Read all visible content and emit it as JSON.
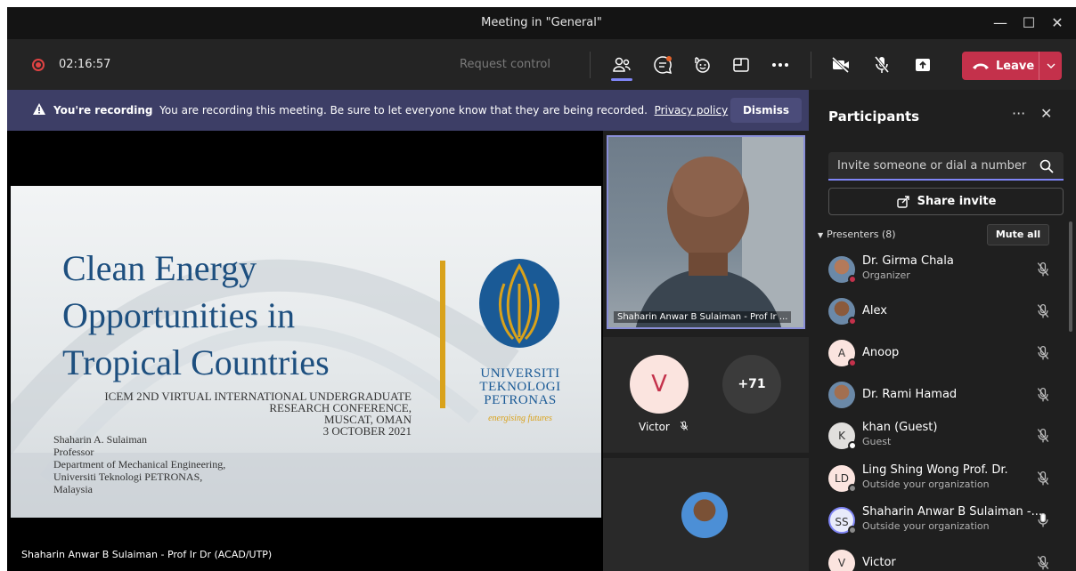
{
  "window": {
    "title": "Meeting in \"General\"",
    "controls": [
      "minimize",
      "maximize",
      "close"
    ]
  },
  "toolbar": {
    "recording_time": "02:16:57",
    "request_control": "Request control",
    "icons": [
      "people-icon",
      "chat-icon",
      "reactions-icon",
      "rooms-icon",
      "more-icon",
      "camera-off-icon",
      "mic-off-icon",
      "share-icon"
    ],
    "leave_label": "Leave",
    "leave_color": "#c4314b"
  },
  "banner": {
    "bold": "You're recording",
    "message": "You are recording this meeting. Be sure to let everyone know that they are being recorded.",
    "link": "Privacy policy",
    "dismiss": "Dismiss"
  },
  "slide": {
    "title_lines": [
      "Clean Energy",
      "Opportunities in",
      "Tropical Countries"
    ],
    "event_line1": "ICEM 2ND VIRTUAL INTERNATIONAL UNDERGRADUATE",
    "event_line2": "RESEARCH CONFERENCE,",
    "event_line3": "MUSCAT, OMAN",
    "event_line4": "3 OCTOBER 2021",
    "author_lines": [
      "Shaharin A. Sulaiman",
      "Professor",
      "Department of Mechanical Engineering,",
      "Universiti Teknologi PETRONAS,",
      "Malaysia"
    ],
    "logo_line1": "UNIVERSITI",
    "logo_line2": "TEKNOLOGI",
    "logo_line3": "PETRONAS",
    "logo_tagline": "energising futures"
  },
  "stage": {
    "caption": "Shaharin Anwar B Sulaiman - Prof Ir Dr (ACAD/UTP)"
  },
  "videos": {
    "speaker_caption": "Shaharin Anwar B Sulaiman - Prof Ir ...",
    "v_initial": "V",
    "v_name": "Victor",
    "overflow": "+71"
  },
  "panel": {
    "title": "Participants",
    "invite_placeholder": "Invite someone or dial a number",
    "share_invite": "Share invite",
    "presenters_label": "Presenters (8)",
    "mute_all": "Mute all",
    "participants": [
      {
        "name": "Dr. Girma Chala",
        "sub": "Organizer",
        "initials": "",
        "avatar": "photo",
        "status": "#c4314b",
        "mic": "off"
      },
      {
        "name": "Alex",
        "sub": "",
        "initials": "",
        "avatar": "photo",
        "status": "#c4314b",
        "mic": "off"
      },
      {
        "name": "Anoop",
        "sub": "",
        "initials": "A",
        "avatar": "#fbe4df",
        "status": "#c4314b",
        "mic": "off"
      },
      {
        "name": "Dr. Rami Hamad",
        "sub": "",
        "initials": "",
        "avatar": "photo",
        "status": "",
        "mic": "off"
      },
      {
        "name": "khan (Guest)",
        "sub": "Guest",
        "initials": "K",
        "avatar": "#e1dfdd",
        "status": "#ffffff",
        "mic": "off"
      },
      {
        "name": "Ling Shing Wong Prof. Dr.",
        "sub": "Outside your organization",
        "initials": "LD",
        "avatar": "#fbe4df",
        "status": "#8a8a8a",
        "mic": "off"
      },
      {
        "name": "Shaharin Anwar B Sulaiman -...",
        "sub": "Outside your organization",
        "initials": "SS",
        "avatar": "#e8ebfa",
        "status": "#8a8a8a",
        "mic": "on"
      },
      {
        "name": "Victor",
        "sub": "",
        "initials": "V",
        "avatar": "#fbe4df",
        "status": "",
        "mic": "off"
      }
    ]
  }
}
